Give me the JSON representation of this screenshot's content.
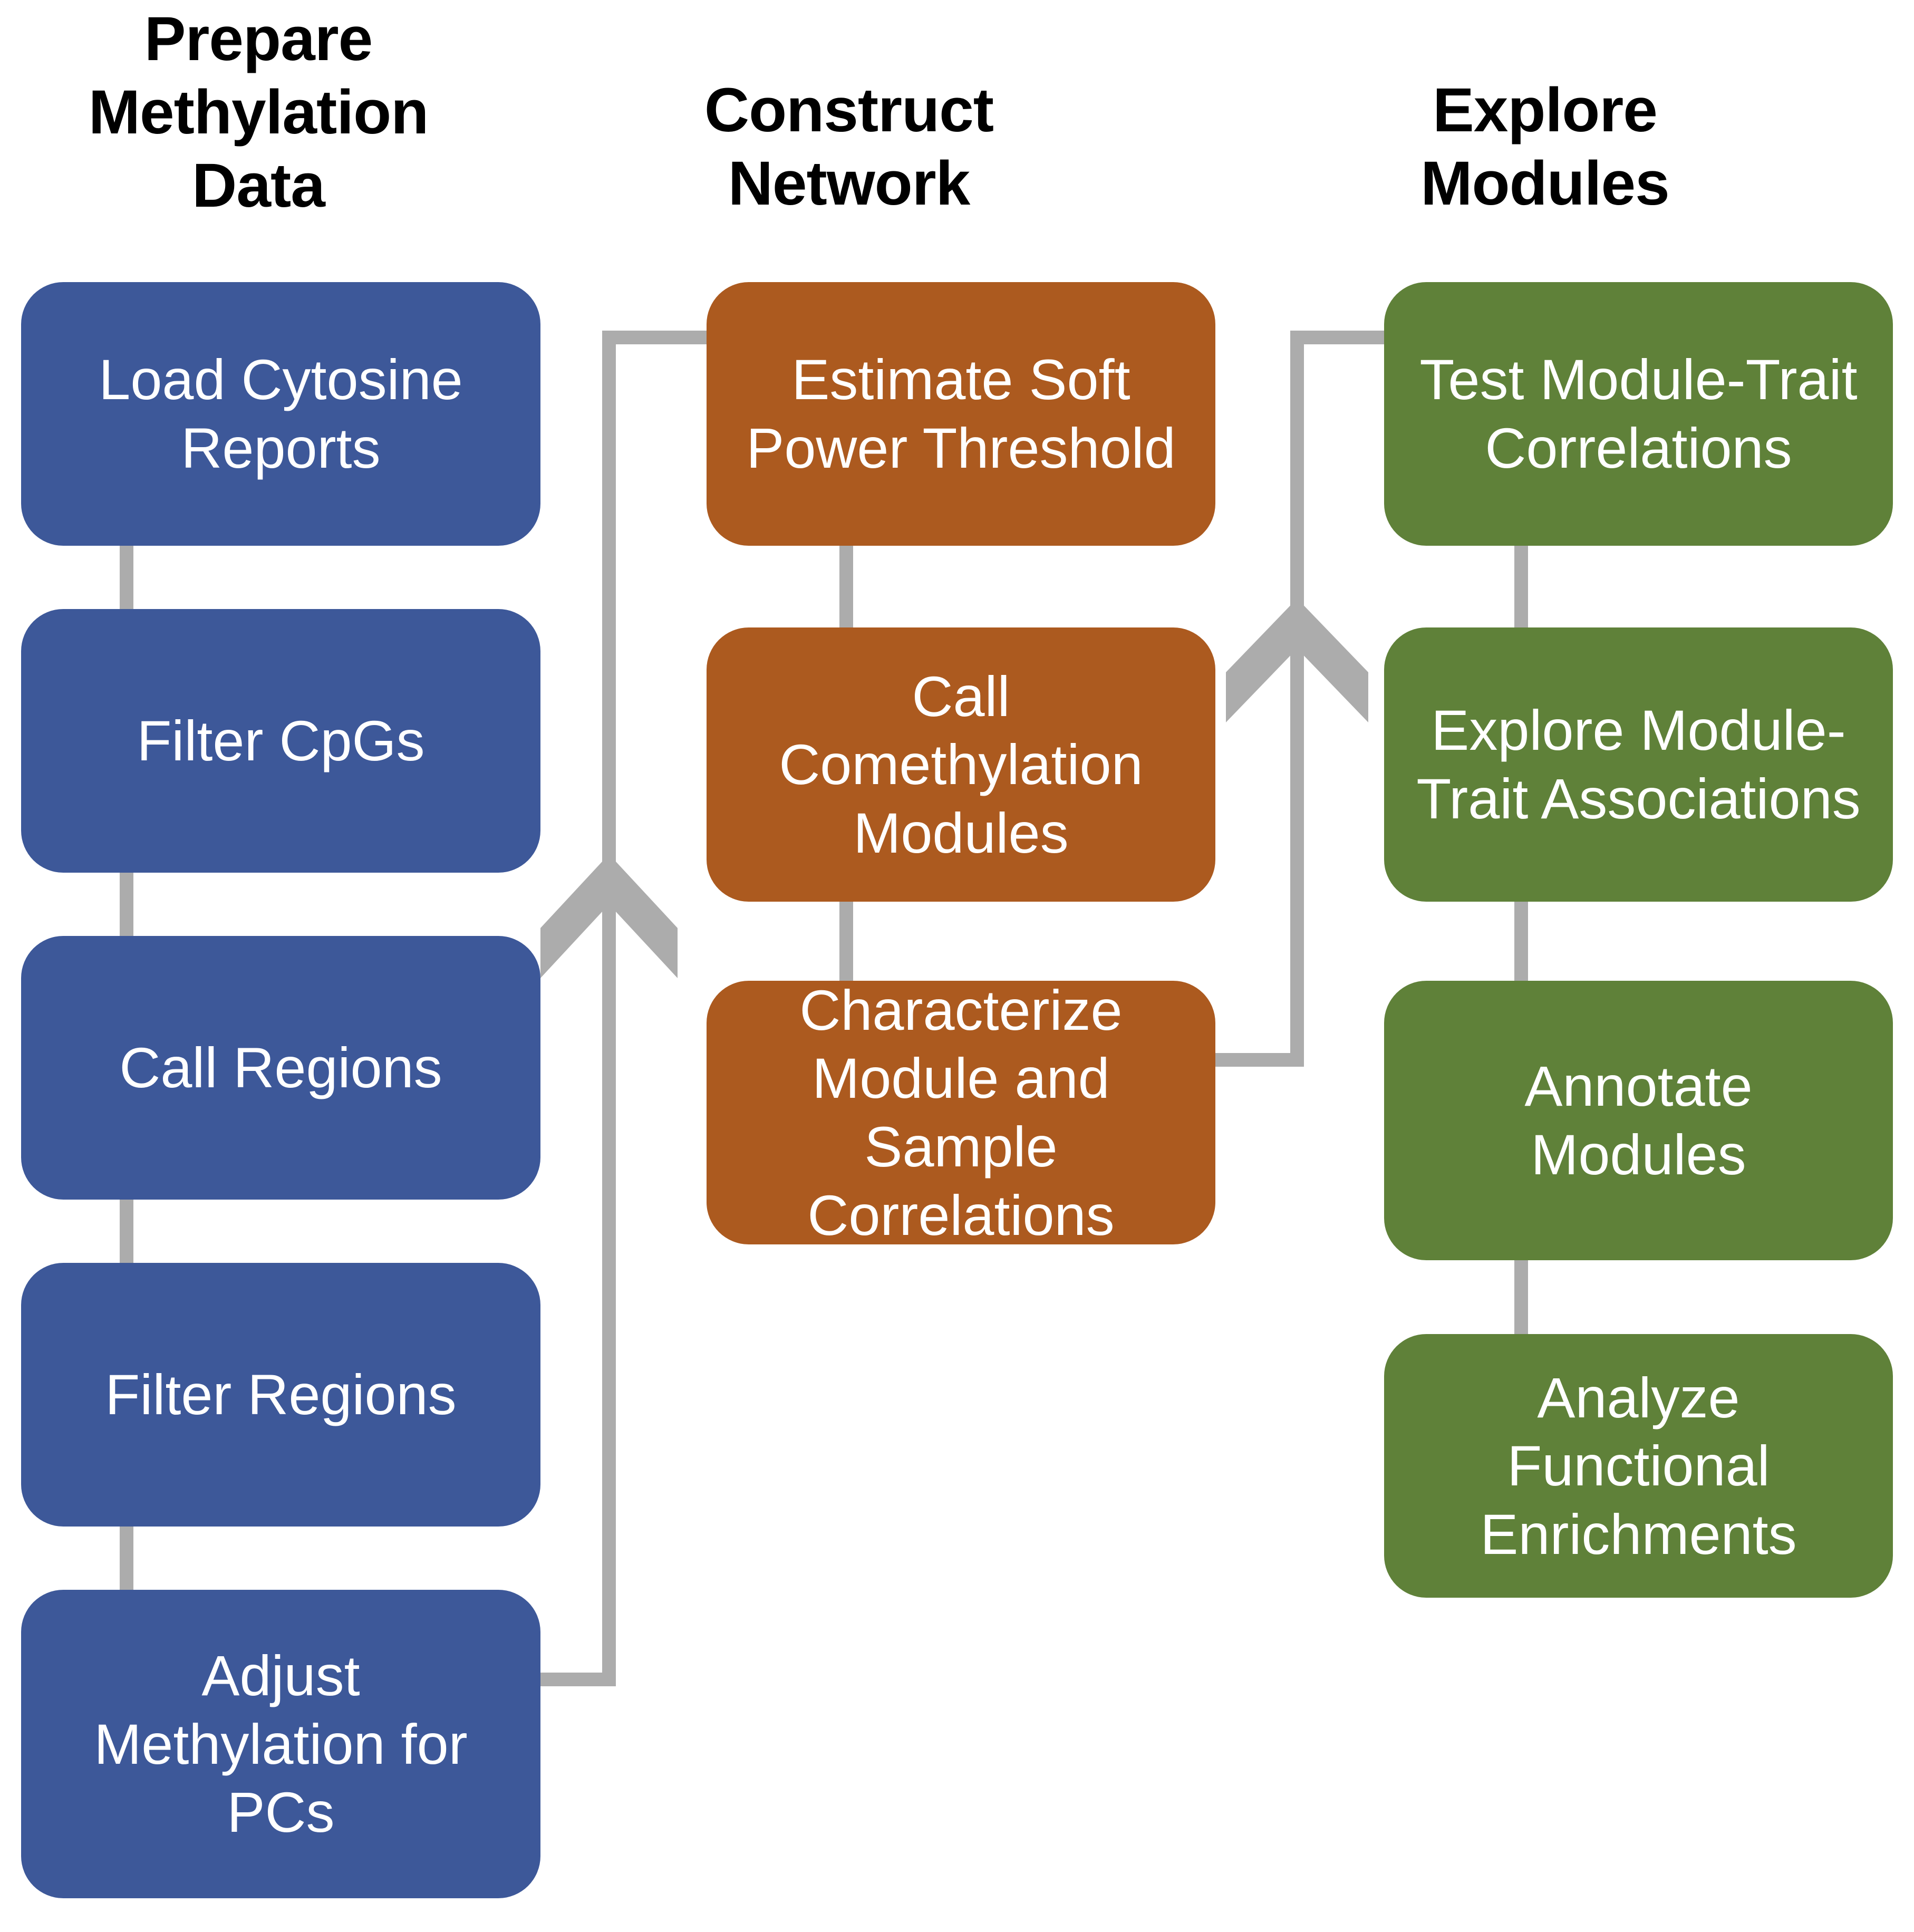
{
  "diagram": {
    "title_font_color": "#000000",
    "background": "#ffffff",
    "connector_color": "#ACACAC",
    "columns": [
      {
        "id": "prepare-methylation-data",
        "title": "Prepare\nMethylation\nData",
        "color": "#3D5899",
        "color_name": "blue",
        "steps": [
          {
            "label": "Load Cytosine\nReports"
          },
          {
            "label": "Filter CpGs"
          },
          {
            "label": "Call Regions"
          },
          {
            "label": "Filter Regions"
          },
          {
            "label": "Adjust\nMethylation for\nPCs"
          }
        ]
      },
      {
        "id": "construct-network",
        "title": "Construct\nNetwork",
        "color": "#AC5A1F",
        "color_name": "orange",
        "steps": [
          {
            "label": "Estimate Soft\nPower Threshold"
          },
          {
            "label": "Call\nComethylation\nModules"
          },
          {
            "label": "Characterize\nModule and\nSample\nCorrelations"
          }
        ]
      },
      {
        "id": "explore-modules",
        "title": "Explore\nModules",
        "color": "#5F8139",
        "color_name": "green",
        "steps": [
          {
            "label": "Test Module-Trait\nCorrelations"
          },
          {
            "label": "Explore Module-\nTrait Associations"
          },
          {
            "label": "Annotate\nModules"
          },
          {
            "label": "Analyze\nFunctional\nEnrichments"
          }
        ]
      }
    ],
    "connectors": [
      {
        "id": "prepare-to-construct",
        "from": "Adjust Methylation for PCs",
        "to": "Estimate Soft Power Threshold",
        "arrow": "up"
      },
      {
        "id": "construct-to-explore",
        "from": "Characterize Module and Sample Correlations",
        "to": "Test Module-Trait Correlations",
        "arrow": "up"
      }
    ]
  }
}
